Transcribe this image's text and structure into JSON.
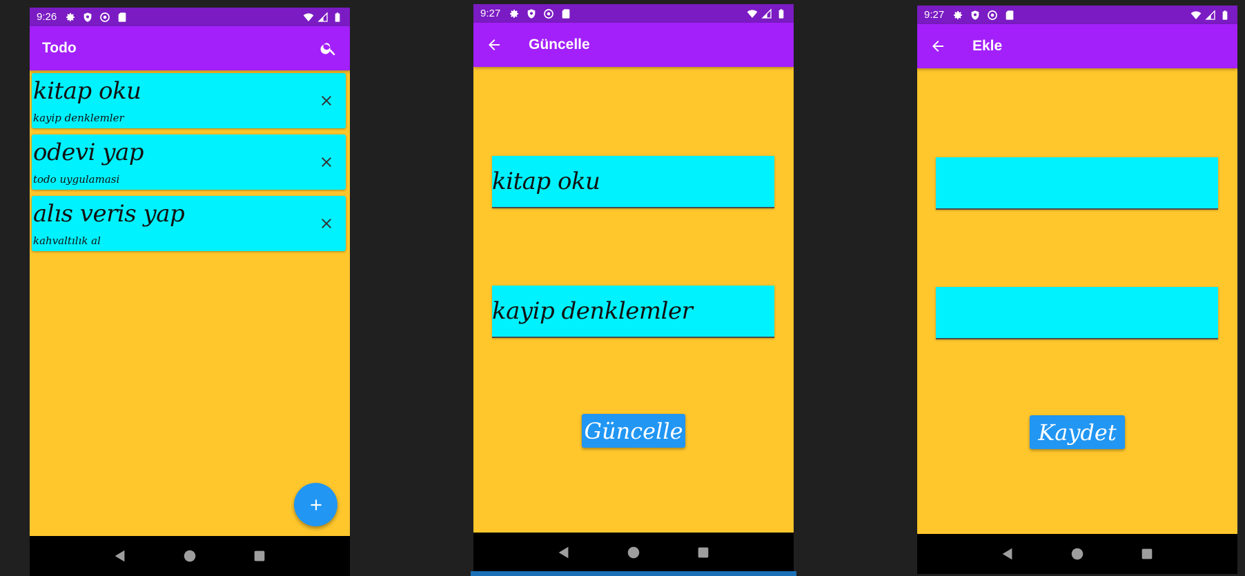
{
  "colors": {
    "statusbar": "#7B1BC3",
    "appbar": "#A320FA",
    "background": "#FFC72C",
    "card": "#00F2FF",
    "button": "#2196F3",
    "navbar": "#000000"
  },
  "screen1": {
    "time": "9:26",
    "title": "Todo",
    "todos": [
      {
        "title": "kitap oku",
        "subtitle": "kayip denklemler"
      },
      {
        "title": "odevi yap",
        "subtitle": "todo uygulamasi"
      },
      {
        "title": "alıs veris yap",
        "subtitle": "kahvaltılık al"
      }
    ],
    "fab_icon": "plus-icon"
  },
  "screen2": {
    "time": "9:27",
    "title": "Güncelle",
    "field1_value": "kitap oku",
    "field2_value": "kayip denklemler",
    "button_label": "Güncelle"
  },
  "screen3": {
    "time": "9:27",
    "title": "Ekle",
    "field1_value": "",
    "field2_value": "",
    "button_label": "Kaydet"
  }
}
